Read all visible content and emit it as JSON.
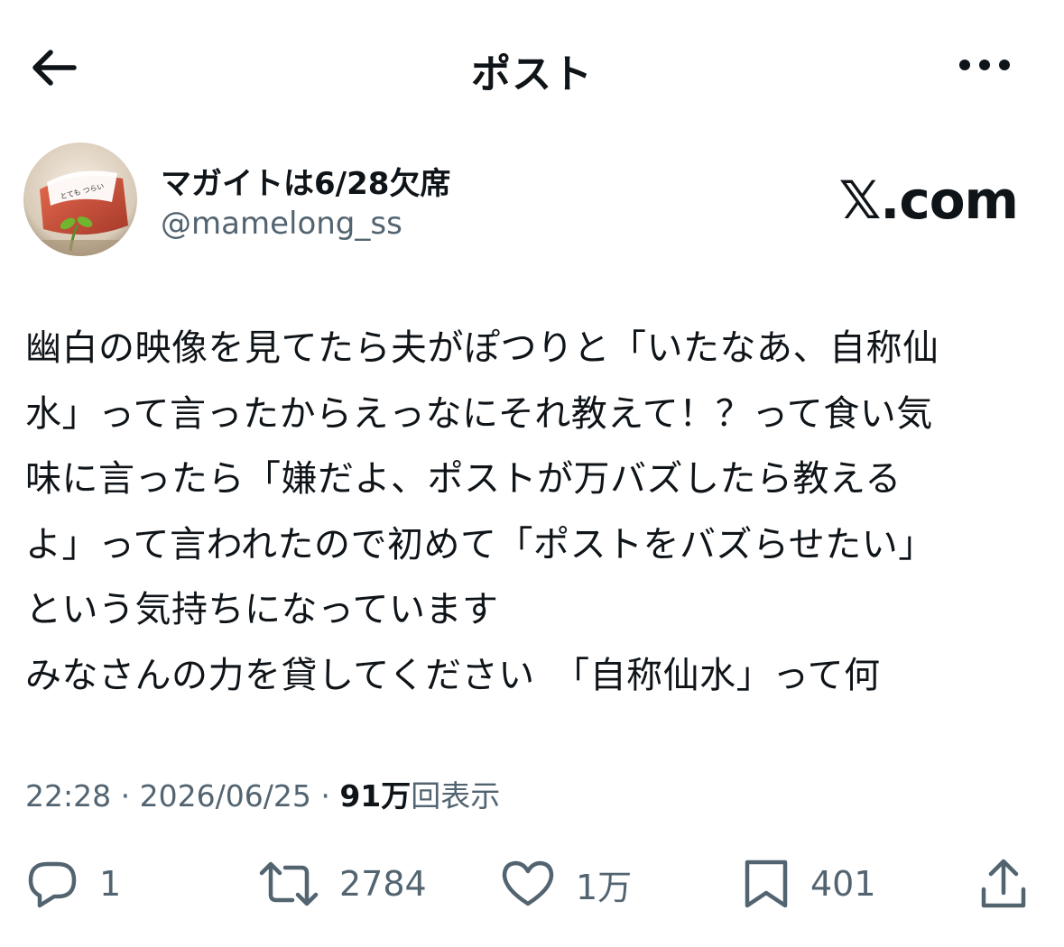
{
  "header": {
    "title": "ポスト",
    "back_icon": "arrow-left-icon",
    "more_icon": "more-horizontal-icon"
  },
  "author": {
    "name": "マガイトは6/28欠席",
    "handle": "@mamelong_ss",
    "avatar_text": "とても つらい"
  },
  "brand": {
    "text": "𝕏.com"
  },
  "post": {
    "lines": [
      "幽白の映像を見てたら夫がぽつりと「いたなあ、自称仙",
      "水」って言ったからえっなにそれ教えて！？って食い気",
      "味に言ったら「嫌だよ、ポストが万バズしたら教える",
      "よ」って言われたので初めて「ポストをバズらせたい」",
      "という気持ちになっています",
      "みなさんの力を貸してください　「自称仙水」って何"
    ]
  },
  "meta": {
    "time": "22:28",
    "date": "2026/06/25",
    "separator": "·",
    "views_count": "91万",
    "views_label": "回表示"
  },
  "actions": {
    "reply_count": "1",
    "repost_count": "2784",
    "like_count": "1万",
    "bookmark_count": "401"
  },
  "colors": {
    "text": "#0f1419",
    "secondary": "#536471",
    "background": "#ffffff"
  }
}
